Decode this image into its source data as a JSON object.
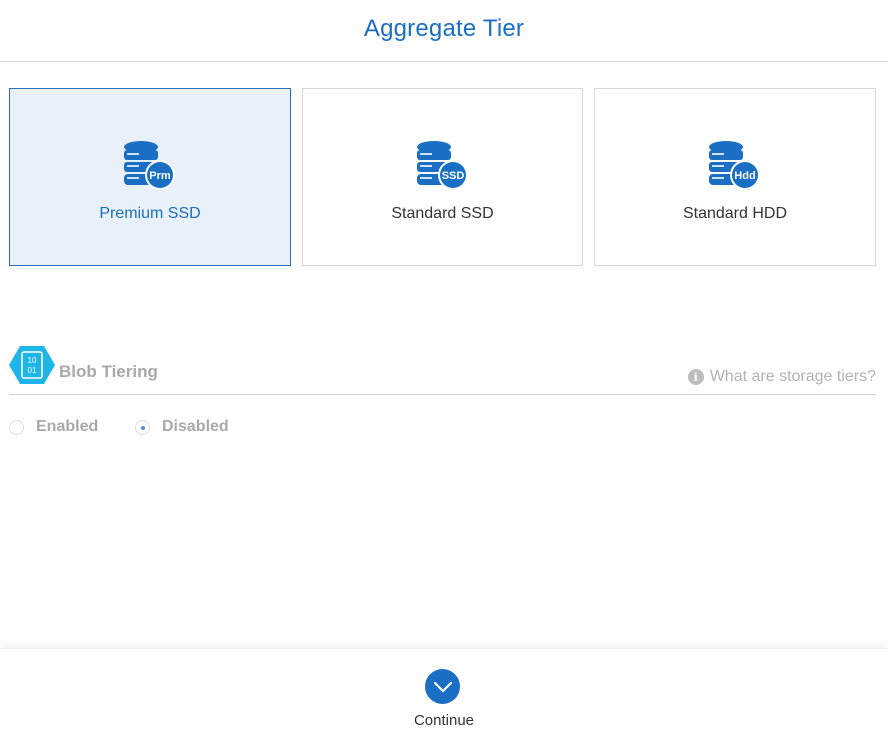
{
  "header": {
    "title": "Aggregate Tier"
  },
  "tiers": [
    {
      "label": "Premium SSD",
      "badge": "Prm",
      "selected": true
    },
    {
      "label": "Standard SSD",
      "badge": "SSD",
      "selected": false
    },
    {
      "label": "Standard HDD",
      "badge": "Hdd",
      "selected": false
    }
  ],
  "blob_tiering": {
    "title": "Blob Tiering",
    "icon_text_top": "10",
    "icon_text_bottom": "01",
    "info_link": "What are storage tiers?",
    "info_icon_glyph": "i",
    "options": [
      {
        "label": "Enabled",
        "checked": false
      },
      {
        "label": "Disabled",
        "checked": true
      }
    ]
  },
  "footer": {
    "continue_label": "Continue"
  },
  "colors": {
    "accent": "#1a6fc4",
    "selected_bg": "#e8f0f9",
    "muted_text": "#a9a9a9",
    "blob_icon": "#1eb6e8"
  },
  "icons": {
    "tier": "database-icon",
    "blob": "binary-hexagon-icon",
    "info": "info-icon",
    "continue": "chevron-down-icon"
  }
}
